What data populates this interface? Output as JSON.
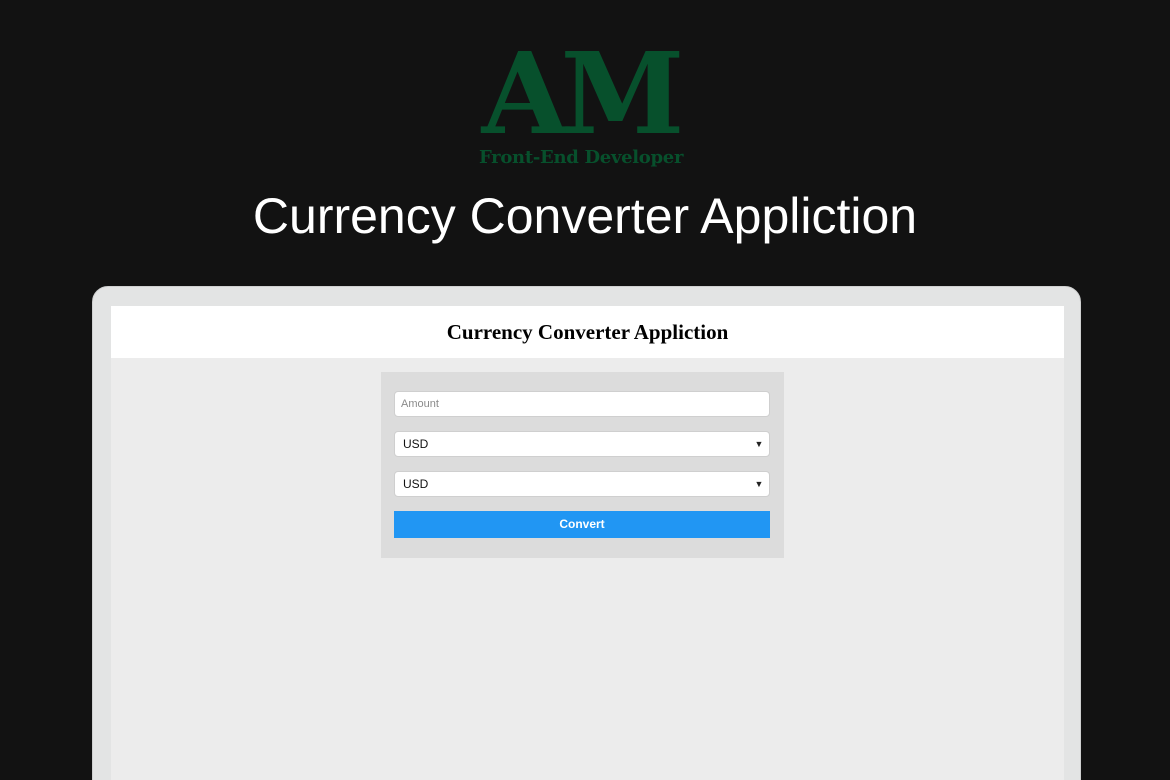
{
  "branding": {
    "logo_mark": "AM",
    "logo_subtitle": "Front-End Developer",
    "accent_color": "#07502c"
  },
  "hero": {
    "title": "Currency Converter Appliction"
  },
  "app": {
    "title": "Currency Converter Appliction",
    "amount": {
      "value": "",
      "placeholder": "Amount"
    },
    "from_currency": {
      "selected": "USD"
    },
    "to_currency": {
      "selected": "USD"
    },
    "convert_label": "Convert",
    "button_color": "#2196f3"
  },
  "icons": {
    "dropdown": "chevron-down-icon"
  }
}
